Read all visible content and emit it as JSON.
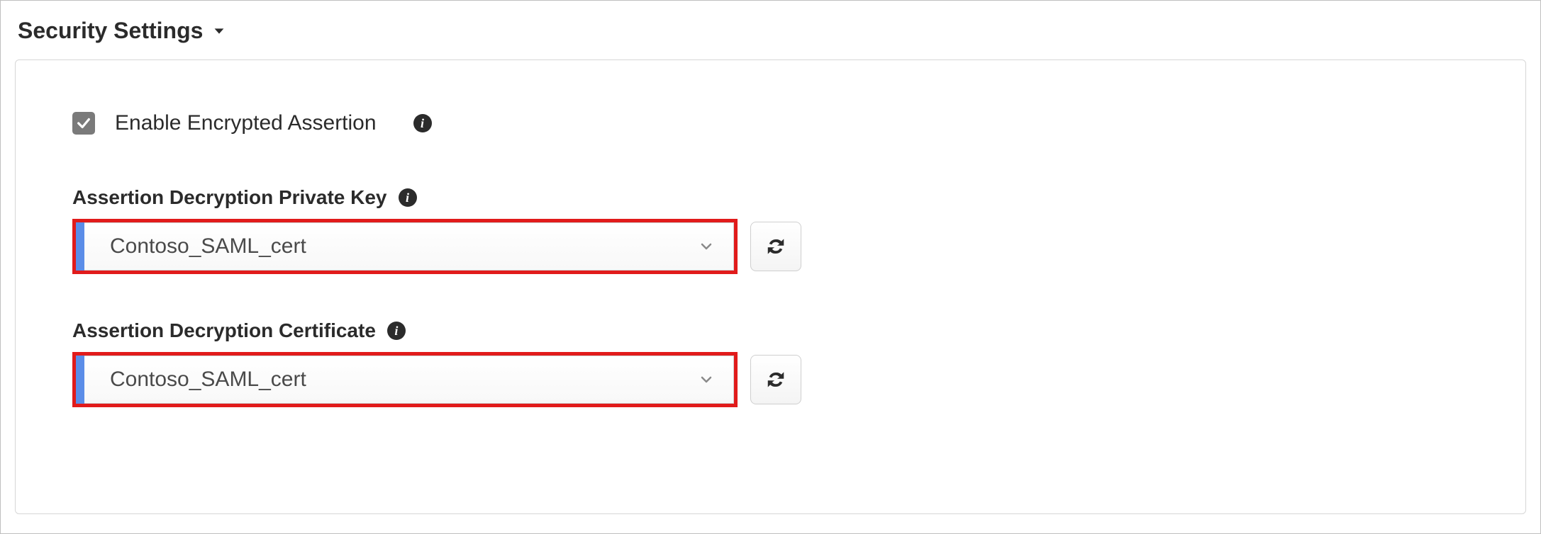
{
  "section": {
    "title": "Security Settings"
  },
  "checkbox": {
    "enabled": true,
    "label": "Enable Encrypted Assertion"
  },
  "fields": {
    "privateKey": {
      "label": "Assertion Decryption Private Key",
      "value": "Contoso_SAML_cert"
    },
    "certificate": {
      "label": "Assertion Decryption Certificate",
      "value": "Contoso_SAML_cert"
    }
  },
  "icons": {
    "info_glyph": "i"
  },
  "colors": {
    "highlight_border": "#e11b1b",
    "accent_blue": "#5b8de8",
    "checkbox_bg": "#7a7a7a"
  }
}
